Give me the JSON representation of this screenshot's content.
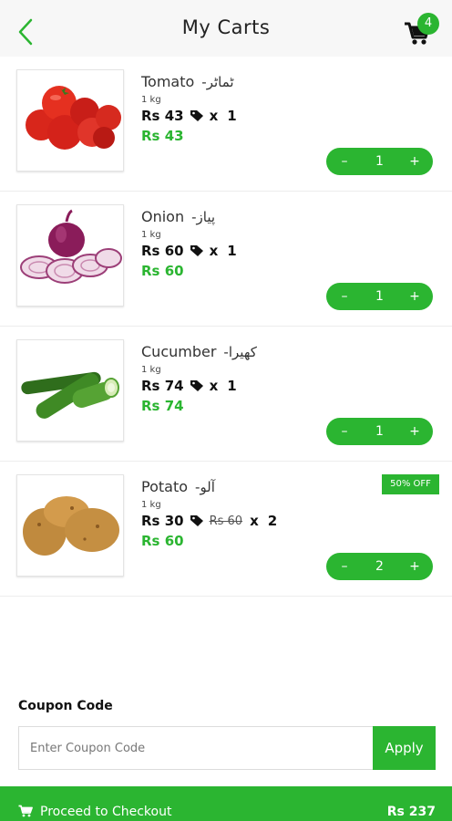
{
  "header": {
    "title": "My Carts",
    "cart_count": "4"
  },
  "items": [
    {
      "name": "Tomato",
      "urdu": "-ٹماٹر",
      "weight": "1 kg",
      "price": "Rs 43",
      "old_price": "",
      "multiplier": "x",
      "quantity": "1",
      "total": "Rs 43",
      "discount": ""
    },
    {
      "name": "Onion",
      "urdu": "-پیاز",
      "weight": "1 kg",
      "price": "Rs 60",
      "old_price": "",
      "multiplier": "x",
      "quantity": "1",
      "total": "Rs 60",
      "discount": ""
    },
    {
      "name": "Cucumber",
      "urdu": "-کھیرا",
      "weight": "1 kg",
      "price": "Rs 74",
      "old_price": "",
      "multiplier": "x",
      "quantity": "1",
      "total": "Rs 74",
      "discount": ""
    },
    {
      "name": "Potato",
      "urdu": "-آلو",
      "weight": "1 kg",
      "price": "Rs 30",
      "old_price": "Rs 60",
      "multiplier": "x",
      "quantity": "2",
      "total": "Rs 60",
      "discount": "50% OFF"
    }
  ],
  "stepper": {
    "minus": "–",
    "plus": "+"
  },
  "coupon": {
    "label": "Coupon Code",
    "placeholder": "Enter Coupon Code",
    "apply_label": "Apply"
  },
  "checkout": {
    "label": "Proceed to Checkout",
    "amount": "Rs 237"
  },
  "colors": {
    "accent": "#2bb531"
  }
}
